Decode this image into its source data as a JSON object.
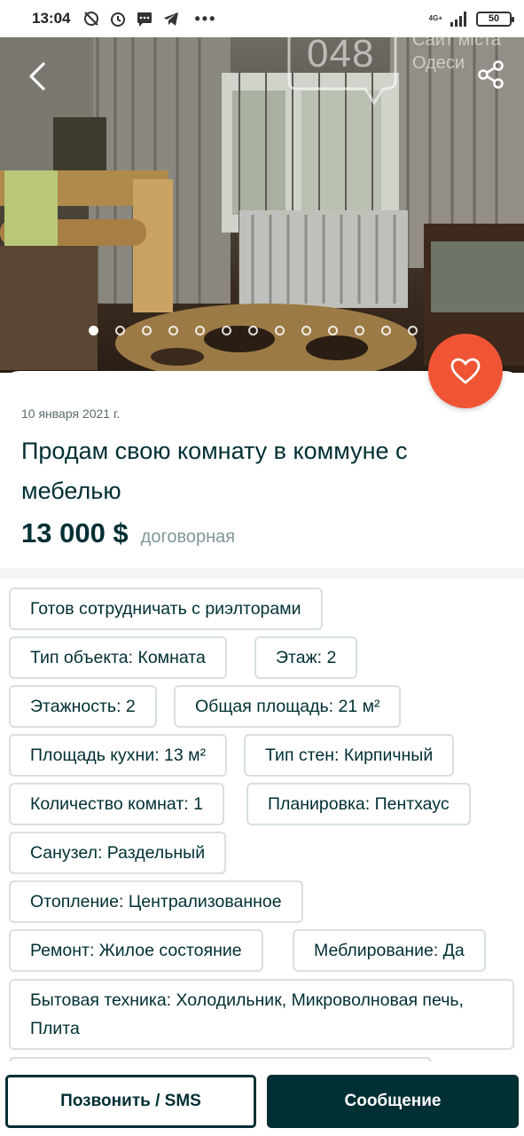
{
  "status_bar": {
    "time": "13:04",
    "network": "4G+",
    "battery": "50",
    "icons": [
      "do-not-disturb-icon",
      "alarm-icon",
      "message-icon",
      "telegram-icon",
      "more-dots-icon",
      "signal-icon",
      "battery-icon"
    ],
    "overflow": "•••"
  },
  "photo": {
    "watermark_number": "048",
    "watermark_text": "Сайт міста Одеси",
    "slide_count": 13,
    "active_slide": 1,
    "icons": [
      "back-arrow-icon",
      "share-icon",
      "heart-icon"
    ]
  },
  "listing": {
    "date": "10 января 2021 г.",
    "title": "Продам свою комнату в коммуне с мебелью",
    "price": "13 000 $",
    "price_note": "договорная"
  },
  "params": [
    "Готов сотрудничать с риэлторами",
    "Тип объекта: Комната",
    "Этаж: 2",
    "Этажность: 2",
    "Общая площадь: 21 м²",
    "Площадь кухни: 13 м²",
    "Тип стен: Кирпичный",
    "Количество комнат: 1",
    "Планировка: Пентхаус",
    "Санузел: Раздельный",
    "Отопление: Централизованное",
    "Ремонт: Жилое состояние",
    "Меблирование: Да",
    "Бытовая техника: Холодильник, Микроволновая печь, Плита"
  ],
  "actions": {
    "call_label": "Позвонить / SMS",
    "message_label": "Сообщение"
  },
  "colors": {
    "brand_dark": "#002f34",
    "favorite": "#ef5535",
    "tag_border": "#d8dfe0"
  }
}
